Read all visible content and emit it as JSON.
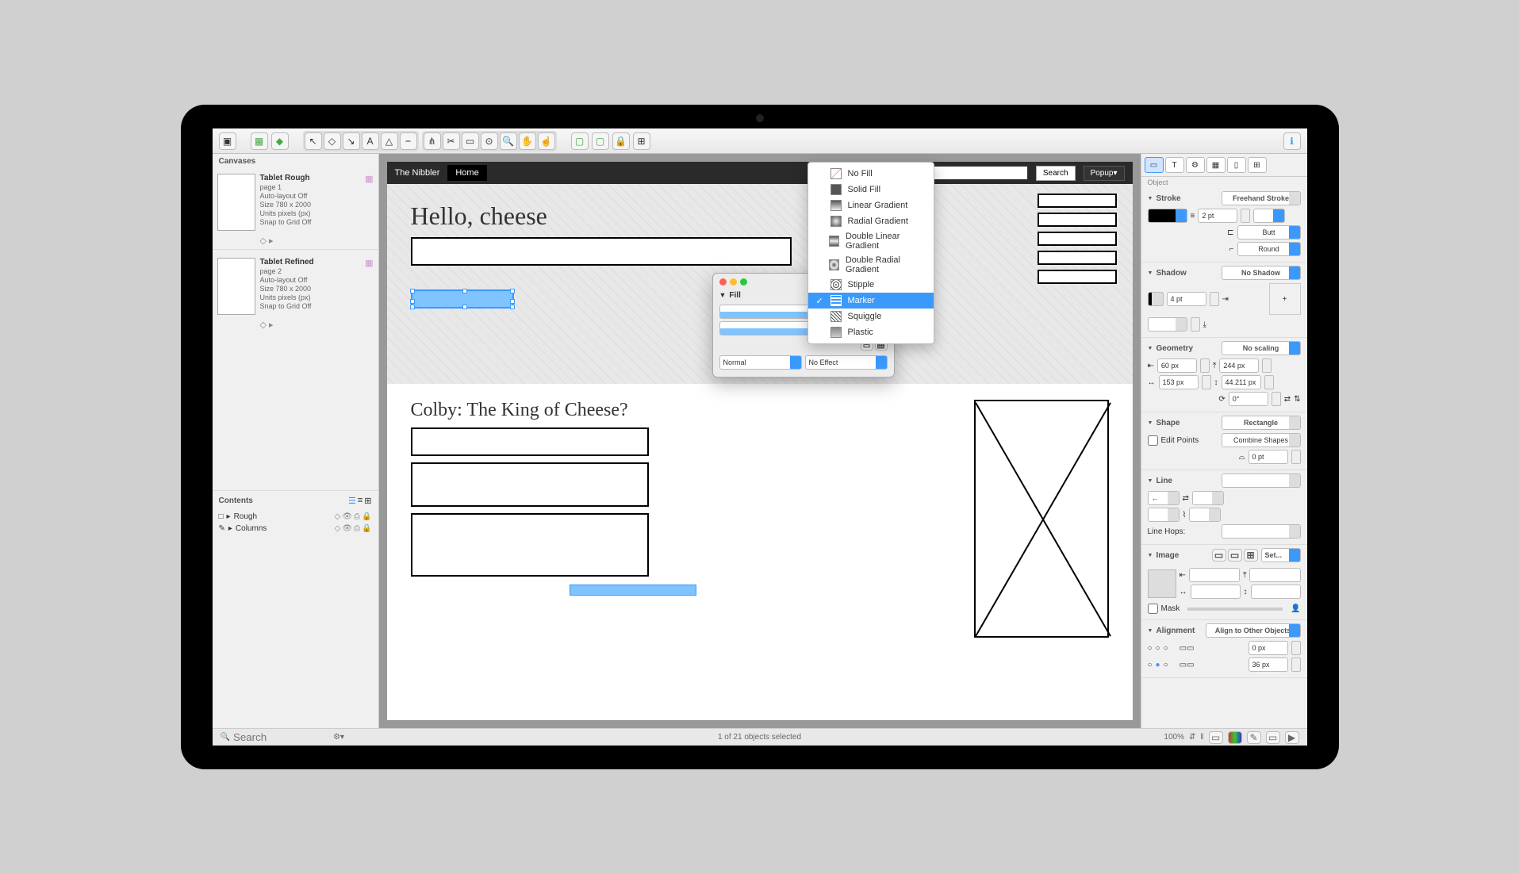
{
  "toolbar": {
    "icons": [
      "panel-left",
      "new-canvas",
      "add-shape",
      "selection",
      "shape",
      "pen",
      "text",
      "line",
      "node",
      "group",
      "ungroup",
      "zoom-out",
      "zoom-in",
      "hand",
      "move",
      "front",
      "back",
      "lock",
      "align",
      "info"
    ]
  },
  "left": {
    "canvases_label": "Canvases",
    "contents_label": "Contents",
    "search_placeholder": "Search",
    "canvases": [
      {
        "title": "Tablet Rough",
        "page": "page 1",
        "autolayout": "Auto-layout Off",
        "size": "Size 780 x 2000",
        "units": "Units pixels (px)",
        "snap": "Snap to Grid Off"
      },
      {
        "title": "Tablet Refined",
        "page": "page 2",
        "autolayout": "Auto-layout Off",
        "size": "Size 780 x 2000",
        "units": "Units pixels (px)",
        "snap": "Snap to Grid Off"
      }
    ],
    "contents": [
      {
        "icon": "□",
        "label": "Rough"
      },
      {
        "icon": "✎",
        "label": "Columns"
      }
    ]
  },
  "canvas": {
    "site_title": "The Nibbler",
    "nav_home": "Home",
    "nav_search": "Search",
    "nav_popup": "Popup▾",
    "headline": "Hello, cheese",
    "article_title": "Colby: The King of Cheese?"
  },
  "fill_popup": {
    "header": "Fill",
    "blend": "Normal",
    "effect": "No Effect"
  },
  "fill_menu": {
    "items": [
      "No Fill",
      "Solid Fill",
      "Linear Gradient",
      "Radial Gradient",
      "Double Linear Gradient",
      "Double Radial Gradient",
      "Stipple",
      "Marker",
      "Squiggle",
      "Plastic"
    ],
    "selected": "Marker"
  },
  "inspector": {
    "label": "Object",
    "stroke": {
      "label": "Stroke",
      "type": "Freehand Stroke",
      "width": "2 pt",
      "cap": "Butt",
      "join": "Round"
    },
    "shadow": {
      "label": "Shadow",
      "type": "No Shadow",
      "offset": "4 pt"
    },
    "geometry": {
      "label": "Geometry",
      "scaling": "No scaling",
      "x": "60 px",
      "y": "244 px",
      "w": "153 px",
      "h": "44.211 px",
      "rotation": "0°"
    },
    "shape": {
      "label": "Shape",
      "type": "Rectangle",
      "edit": "Edit Points",
      "combine": "Combine Shapes",
      "radius": "0 pt"
    },
    "line": {
      "label": "Line",
      "hops": "Line Hops:"
    },
    "image": {
      "label": "Image",
      "set": "Set...",
      "mask": "Mask"
    },
    "alignment": {
      "label": "Alignment",
      "mode": "Align to Other Objects",
      "gap1": "0 px",
      "gap2": "36 px"
    }
  },
  "status": {
    "selection": "1 of 21 objects selected",
    "zoom": "100%"
  }
}
